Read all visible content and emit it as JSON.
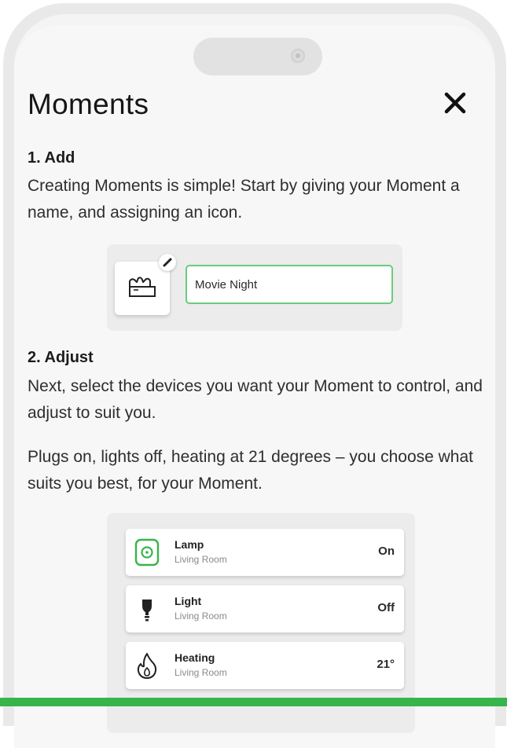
{
  "header": {
    "title": "Moments",
    "close_icon": "close-icon"
  },
  "step_add": {
    "heading": "1. Add",
    "description": "Creating Moments is simple! Start by giving your Moment a name, and assigning an icon.",
    "icon": "clapperboard-icon",
    "edit_icon": "pencil-icon",
    "name_value": "Movie Night"
  },
  "step_adjust": {
    "heading": "2. Adjust",
    "description": "Next, select the devices you want your Moment to control, and adjust to suit you.",
    "note": "Plugs on, lights off, heating at 21 degrees – you choose what suits you best, for your Moment.",
    "devices": [
      {
        "name": "Lamp",
        "room": "Living Room",
        "state": "On",
        "icon": "plug-icon"
      },
      {
        "name": "Light",
        "room": "Living Room",
        "state": "Off",
        "icon": "bulb-icon"
      },
      {
        "name": "Heating",
        "room": "Living Room",
        "state": "21°",
        "icon": "flame-icon"
      }
    ]
  },
  "colors": {
    "accent": "#38b54a",
    "field_border": "#6ccb7a",
    "screen_bg": "#f7f7f7"
  }
}
